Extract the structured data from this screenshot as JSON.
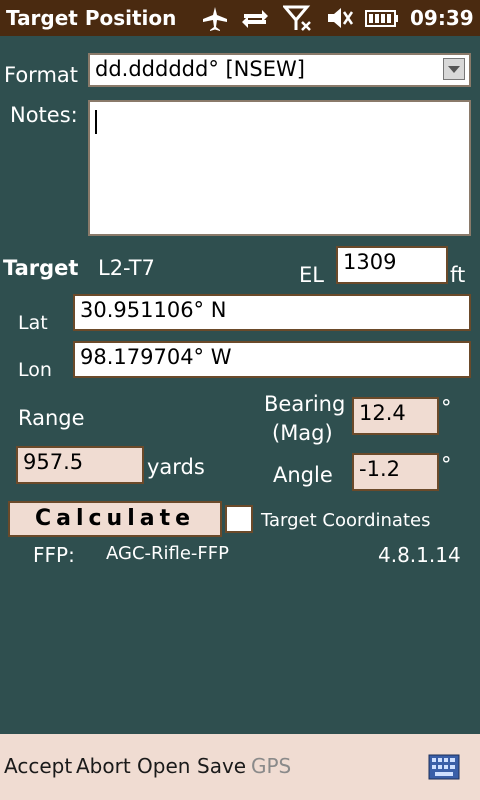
{
  "status_bar": {
    "title": "Target Position",
    "time": "09:39",
    "icons": [
      "airplane-icon",
      "sync-arrows-icon",
      "no-signal-icon",
      "volume-mute-icon",
      "battery-icon"
    ]
  },
  "form": {
    "format_label": "Format",
    "format_value": "dd.dddddd° [NSEW]",
    "notes_label": "Notes:",
    "notes_value": "",
    "target_label": "Target",
    "target_id": "L2-T7",
    "el_label": "EL",
    "el_value": "1309",
    "el_unit": "ft",
    "lat_label": "Lat",
    "lat_value": "30.951106° N",
    "lon_label": "Lon",
    "lon_value": "98.179704° W",
    "range_label": "Range",
    "range_value": "957.5",
    "range_unit": "yards",
    "bearing_label_line1": "Bearing",
    "bearing_label_line2": "(Mag)",
    "bearing_value": "12.4",
    "bearing_unit": "°",
    "angle_label": "Angle",
    "angle_value": "-1.2",
    "angle_unit": "°",
    "calculate_label": "Calculate",
    "target_coordinates_label": "Target Coordinates",
    "ffp_label": "FFP:",
    "ffp_value": "AGC-Rifle-FFP",
    "version": "4.8.1.14"
  },
  "menu": {
    "accept": "Accept",
    "abort": "Abort",
    "open": "Open",
    "save": "Save",
    "gps": "GPS"
  },
  "colors": {
    "background": "#2f4f4f",
    "status_bar": "#4a2a10",
    "field_pink": "#f0dcd2",
    "field_border": "#6b4a2a"
  }
}
